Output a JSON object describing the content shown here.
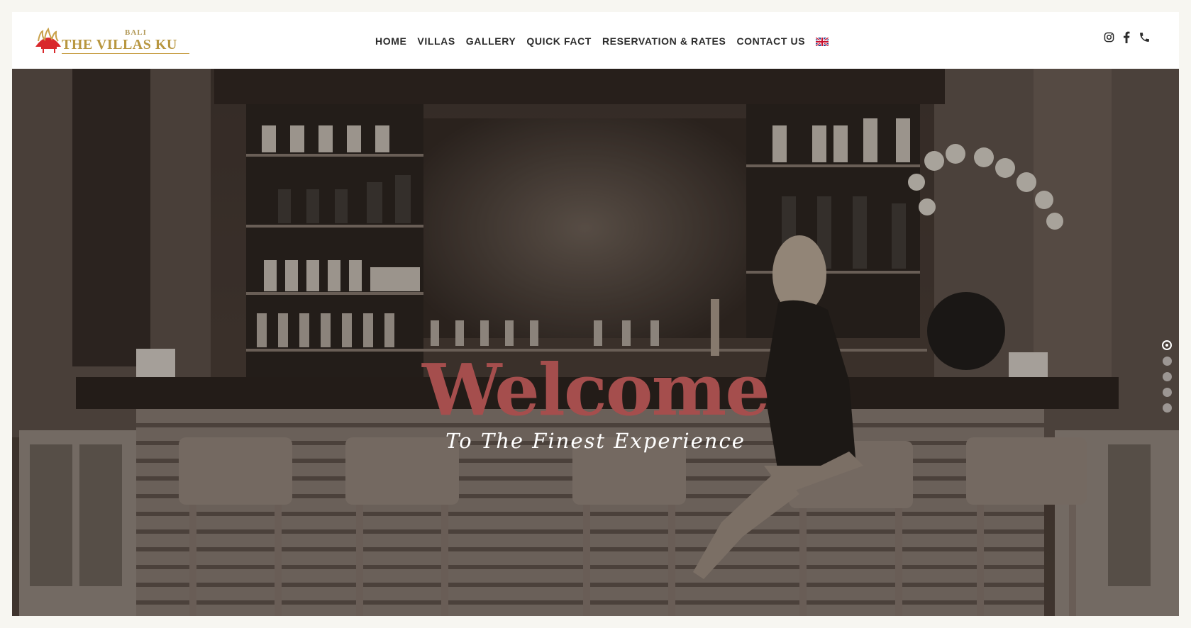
{
  "brand": {
    "small": "BALI",
    "name": "THE VILLAS KU"
  },
  "nav": {
    "items": [
      "HOME",
      "VILLAS",
      "GALLERY",
      "QUICK FACT",
      "RESERVATION & RATES",
      "CONTACT US"
    ],
    "language_icon": "uk-flag-icon"
  },
  "social": {
    "icons": [
      "instagram-icon",
      "facebook-icon",
      "phone-icon"
    ]
  },
  "hero": {
    "title": "Welcome",
    "subtitle": "To The Finest Experience",
    "title_color": "#a54e4d",
    "slides": 5,
    "active_slide": 1
  },
  "colors": {
    "background": "#f7f6f1",
    "header": "#ffffff",
    "brand_gold": "#b8963f",
    "logo_red": "#d9282b"
  }
}
